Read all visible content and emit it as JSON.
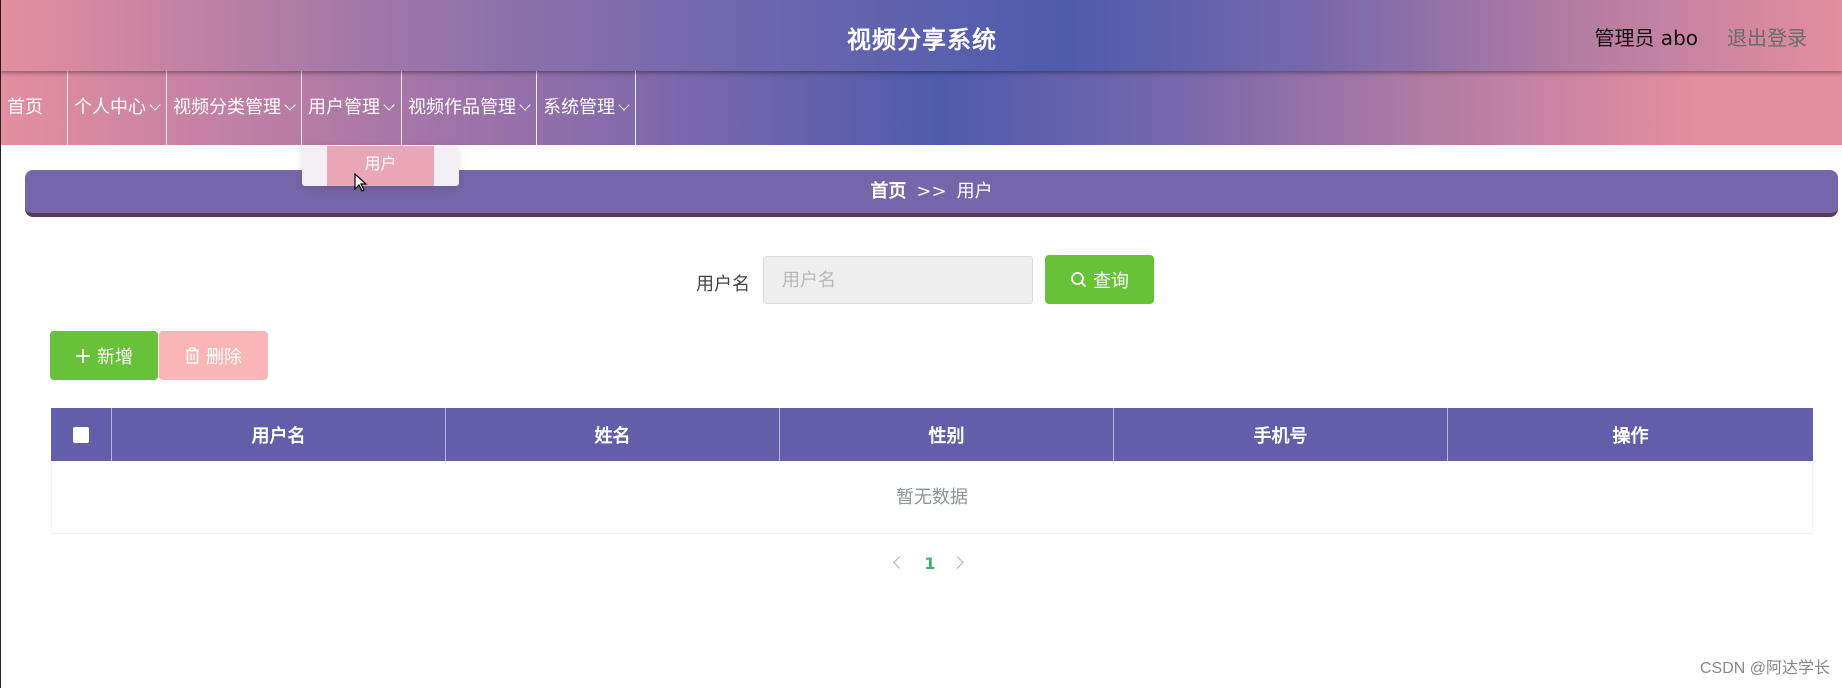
{
  "header": {
    "title": "视频分享系统",
    "user_label": "管理员 abo",
    "logout_label": "退出登录"
  },
  "nav": {
    "items": [
      {
        "label": "首页"
      },
      {
        "label": "个人中心"
      },
      {
        "label": "视频分类管理"
      },
      {
        "label": "用户管理"
      },
      {
        "label": "视频作品管理"
      },
      {
        "label": "系统管理"
      }
    ],
    "dropdown_item": "用户"
  },
  "breadcrumb": {
    "home": "首页",
    "separator": ">>",
    "current": "用户"
  },
  "search": {
    "label": "用户名",
    "placeholder": "用户名",
    "button_label": "查询"
  },
  "actions": {
    "add_label": "新增",
    "delete_label": "删除"
  },
  "table": {
    "columns": [
      "用户名",
      "姓名",
      "性别",
      "手机号",
      "操作"
    ],
    "empty_text": "暂无数据"
  },
  "pagination": {
    "current_page": "1"
  },
  "watermark": "CSDN @阿达学长",
  "colors": {
    "primary_green": "#67c23a",
    "danger_light": "#fab6b6",
    "table_header": "#625ea9",
    "breadcrumb": "#7466a8"
  }
}
